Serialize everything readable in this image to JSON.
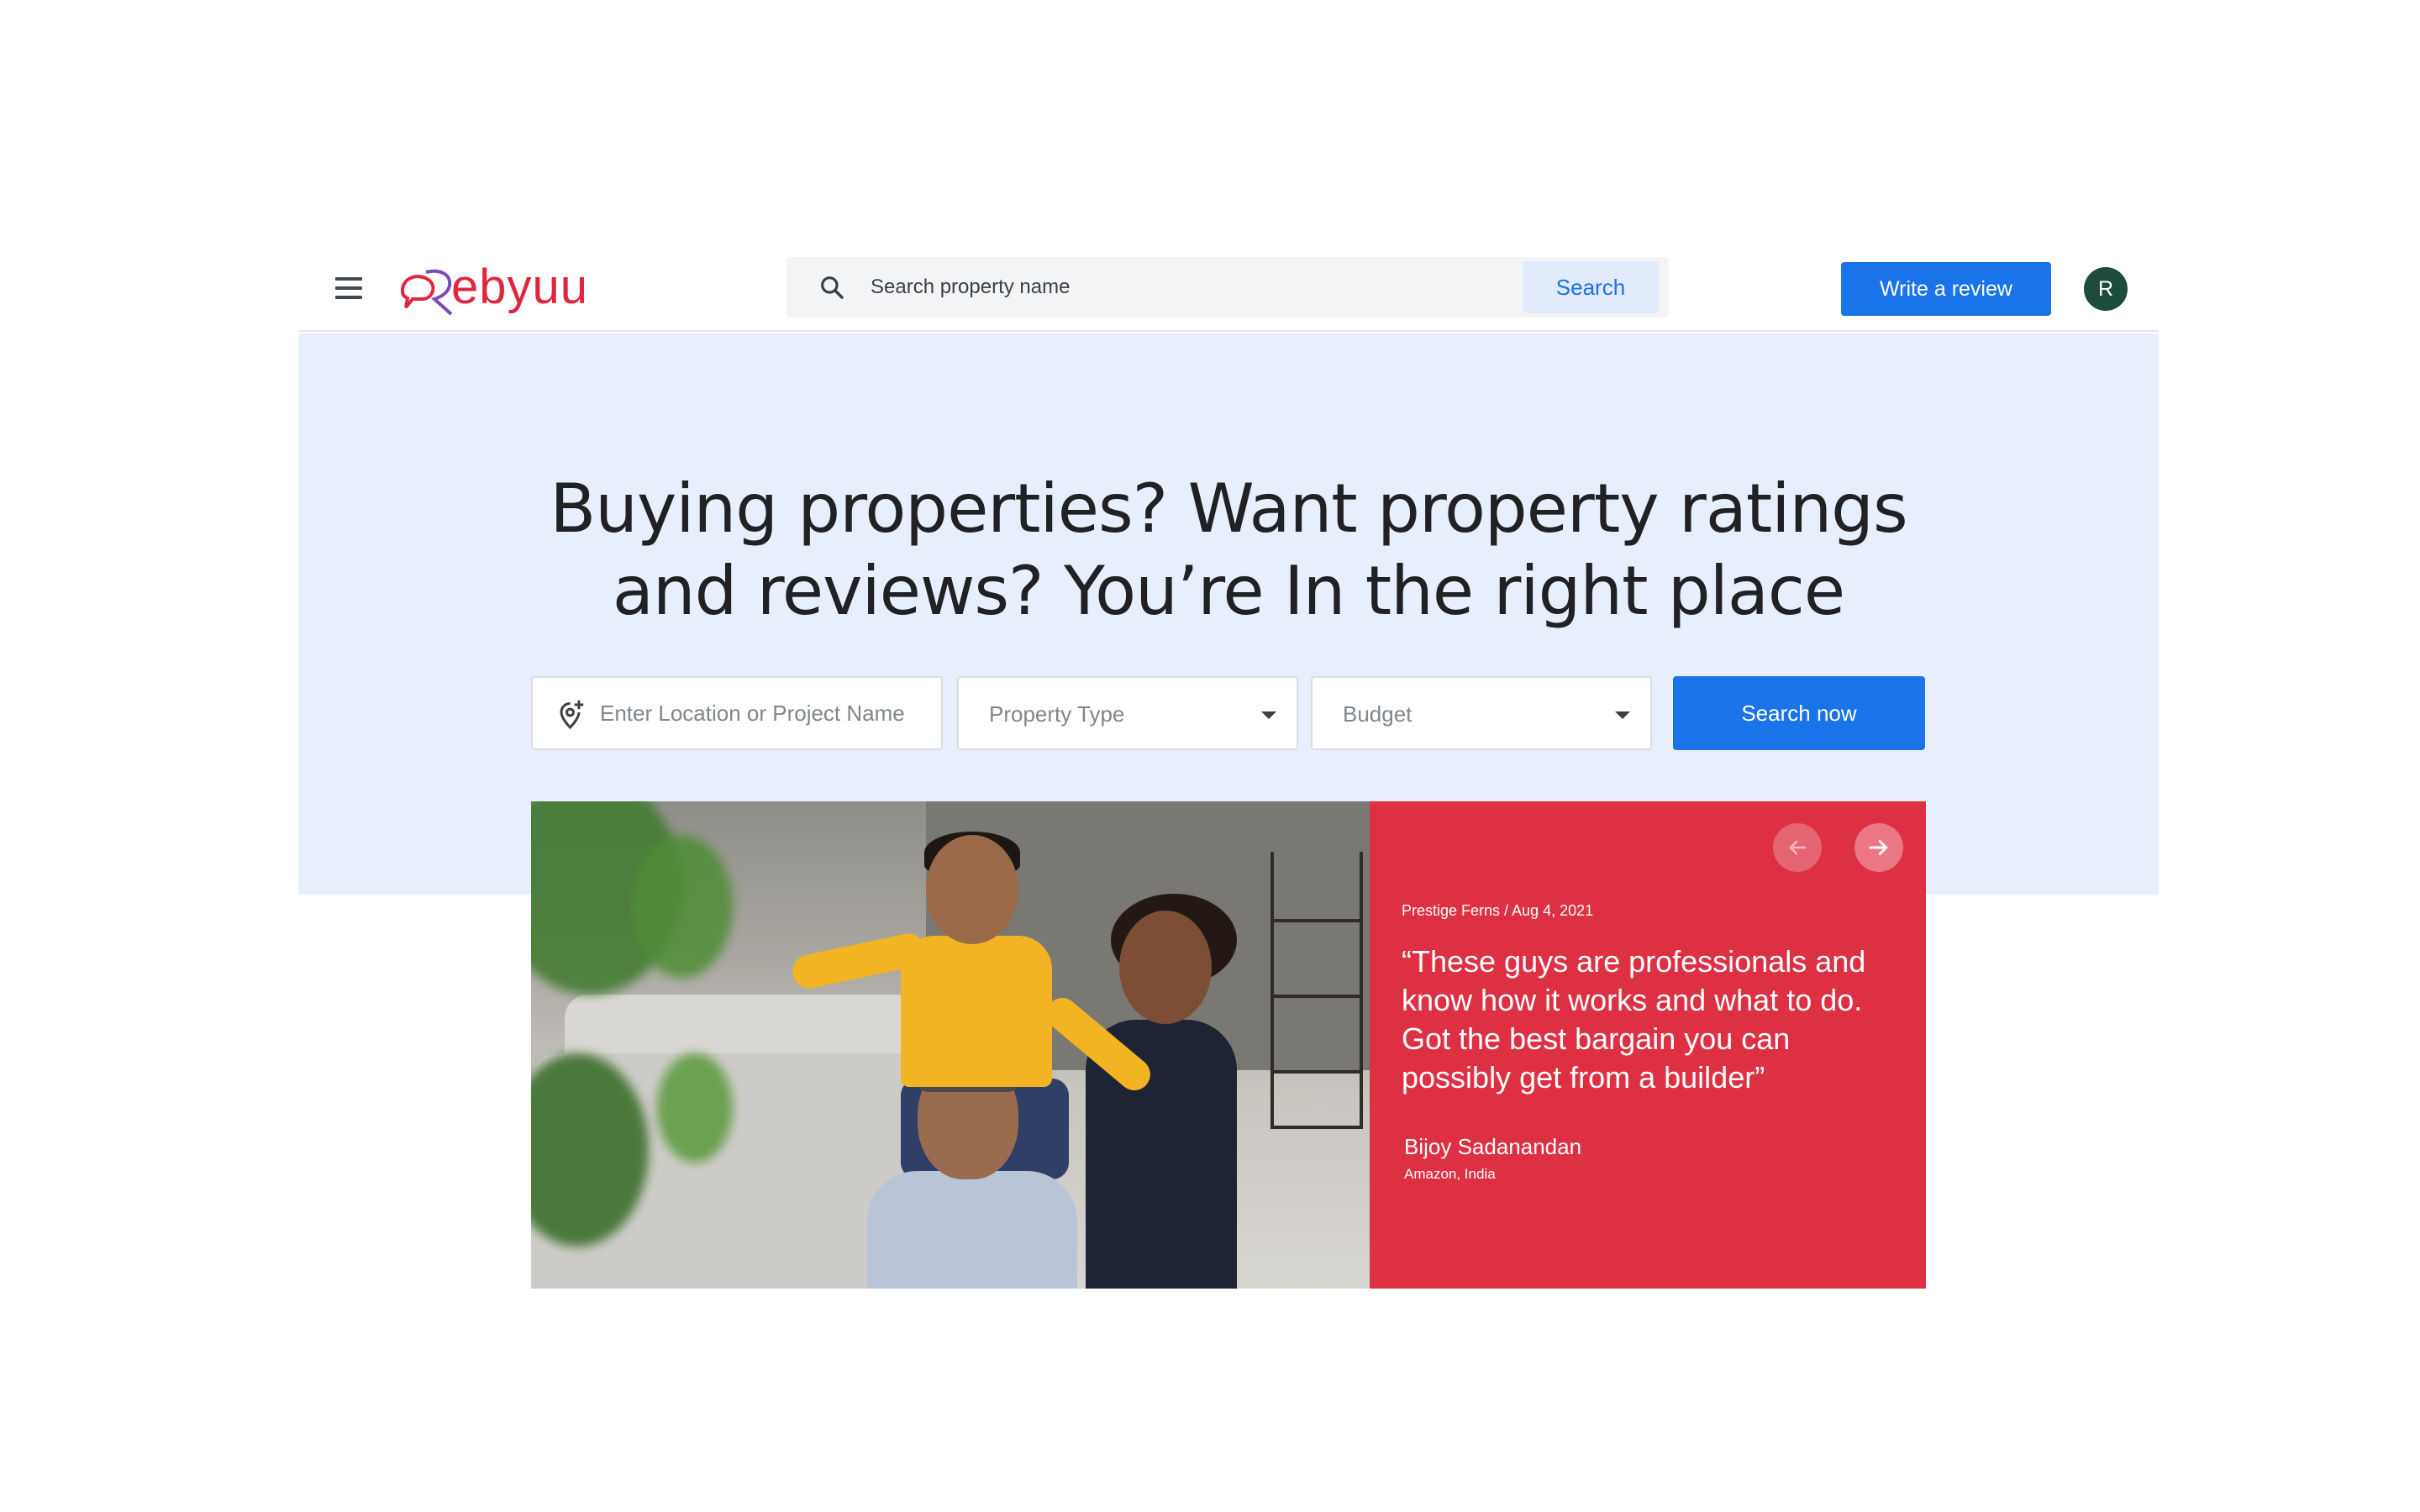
{
  "header": {
    "logo_text": "ebyuu",
    "search_placeholder": "Search property name",
    "search_button": "Search",
    "write_review_button": "Write a review",
    "avatar_initial": "R"
  },
  "hero": {
    "title": "Buying properties? Want property ratings and reviews? You’re In the right place",
    "location_placeholder": "Enter Location or Project Name",
    "property_type_label": "Property Type",
    "budget_label": "Budget",
    "search_now_button": "Search now"
  },
  "testimonial": {
    "meta": "Prestige Ferns / Aug 4, 2021",
    "quote": "“These guys are professionals and know how it works and what to do. Got the best bargain you can possibly get from a builder”",
    "author": "Bijoy Sadanandan",
    "company": "Amazon, India"
  },
  "icons": {
    "menu": "hamburger-menu-icon",
    "search": "search-icon",
    "location": "location-pin-add-icon",
    "dropdown": "caret-down-icon",
    "prev": "arrow-left-icon",
    "next": "arrow-right-icon"
  },
  "colors": {
    "primary_blue": "#1a73e8",
    "brand_red": "#e0263f",
    "hero_bg": "#e8effc",
    "testimonial_bg": "#dd3043",
    "avatar_bg": "#1d4d3a"
  }
}
